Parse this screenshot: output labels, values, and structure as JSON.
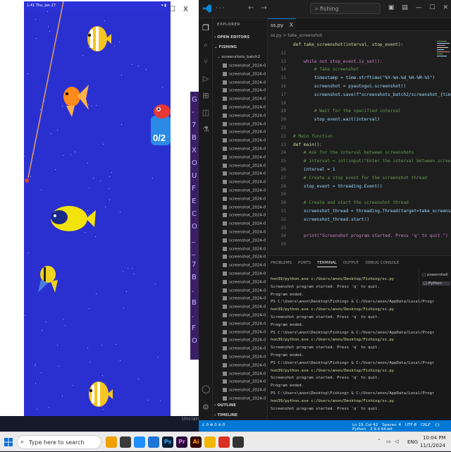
{
  "phone": {
    "status_time": "1:41 Thu, Jan 27",
    "window_restore": "☐",
    "window_close": "X",
    "catch_progress": "0/2"
  },
  "vscode": {
    "search": "fishing",
    "tab": "ss.py",
    "tab_close": "X",
    "breadcrumb": "ss.py > take_screenshot",
    "sidebar": {
      "header": "EXPLORER",
      "open_editors": "OPEN EDITORS",
      "root": "FISHING",
      "folder": "screenshots_batch2",
      "files": [
        "screenshot_2024-0...",
        "screenshot_2024-07...",
        "screenshot_2024-07...",
        "screenshot_2024-07...",
        "screenshot_2024-07...",
        "screenshot_2024-07...",
        "screenshot_2024-07...",
        "screenshot_2024-07...",
        "screenshot_2024-07...",
        "screenshot_2024-07...",
        "screenshot_2024-07...",
        "screenshot_2024-07...",
        "screenshot_2024-07...",
        "screenshot_2024-07...",
        "screenshot_2024-07...",
        "screenshot_2024-07...",
        "screenshot_2024-07...",
        "screenshot_2024-07...",
        "screenshot_2024-07...",
        "screenshot_2024-07...",
        "screenshot_2024-07...",
        "screenshot_2024-07...",
        "screenshot_2024-07...",
        "screenshot_2024-07...",
        "screenshot_2024-07...",
        "screenshot_2024-07...",
        "screenshot_2024-07...",
        "screenshot_2024-07...",
        "screenshot_2024-07...",
        "screenshot_2024-07...",
        "screenshot_2024-07...",
        "screenshot_2024-07...",
        "screenshot_2024-07...",
        "screenshot_2024-07...",
        "screenshot_2024-07...",
        "screenshot_2024-07...",
        "screenshot_2024-07...",
        "screenshot_2024-07...",
        "screenshot_2024-07...",
        "screenshot_2024-07...",
        "screenshot_2024-07..."
      ],
      "outline": "OUTLINE",
      "timeline": "TIMELINE"
    },
    "code_lines": [
      {
        "n": "",
        "t": "def take_screenshot(interval, stop_event):"
      },
      {
        "n": "12",
        "t": ""
      },
      {
        "n": "13",
        "t": "    while not stop_event.is_set():"
      },
      {
        "n": "14",
        "t": "        # Take screenshot"
      },
      {
        "n": "15",
        "t": "        timestamp = time.strftime(\"%Y-%m-%d_%H-%M-%S\")"
      },
      {
        "n": "16",
        "t": "        screenshot = pyautogui.screenshot()"
      },
      {
        "n": "17",
        "t": "        screenshot.save(f\"screenshots_batch2/screenshot_{timestamp}.png\")"
      },
      {
        "n": "18",
        "t": ""
      },
      {
        "n": "19",
        "t": "        # Wait for the specified interval"
      },
      {
        "n": "20",
        "t": "        stop_event.wait(interval)"
      },
      {
        "n": "21",
        "t": ""
      },
      {
        "n": "22",
        "t": "# Main function"
      },
      {
        "n": "23",
        "t": "def main():"
      },
      {
        "n": "24",
        "t": "    # Ask for the interval between screenshots"
      },
      {
        "n": "25",
        "t": "    # interval = int(input(\"Enter the interval between screenshots (in seconds): \"))"
      },
      {
        "n": "26",
        "t": "    interval = 1"
      },
      {
        "n": "27",
        "t": "    # Create a stop event for the screenshot thread"
      },
      {
        "n": "28",
        "t": "    stop_event = threading.Event()"
      },
      {
        "n": "29",
        "t": ""
      },
      {
        "n": "30",
        "t": "    # Create and start the screenshot thread"
      },
      {
        "n": "31",
        "t": "    screenshot_thread = threading.Thread(target=take_screenshot, args=(interval, sto"
      },
      {
        "n": "32",
        "t": "    screenshot_thread.start()"
      },
      {
        "n": "33",
        "t": ""
      },
      {
        "n": "34",
        "t": "    print(\"Screenshot program started. Press 'q' to quit.\")"
      },
      {
        "n": "35",
        "t": ""
      }
    ],
    "panel_tabs": [
      "PROBLEMS",
      "PORTS",
      "TERMINAL",
      "OUTPUT",
      "DEBUG CONSOLE"
    ],
    "terminal_list": [
      "powershell",
      "Python"
    ],
    "terminal_lines": [
      "hon39/python.exe c:/Users/anon/Desktop/Fishing/ss.py",
      "Screenshot program started. Press 'q' to quit.",
      "Program ended.",
      "PS C:\\Users\\anon\\Desktop\\Fishing> & C:/Users/anon/AppData/Local/Programs/Python/Pyt",
      "hon39/python.exe c:/Users/anon/Desktop/Fishing/ss.py",
      "Screenshot program started. Press 'q' to quit.",
      "Program ended.",
      "PS C:\\Users\\anon\\Desktop\\Fishing> & C:/Users/anon/AppData/Local/Programs/Python/Pyt",
      "hon39/python.exe c:/Users/anon/Desktop/Fishing/ss.py",
      "Screenshot program started. Press 'q' to quit.",
      "Program ended.",
      "PS C:\\Users\\anon\\Desktop\\Fishing> & C:/Users/anon/AppData/Local/Programs/Python/Pyt",
      "hon39/python.exe c:/Users/anon/Desktop/Fishing/ss.py",
      "Screenshot program started. Press 'q' to quit.",
      "Program ended.",
      "PS C:\\Users\\anon\\Desktop\\Fishing> & C:/Users/anon/AppData/Local/Programs/Python/Pyt",
      "hon39/python.exe c:/Users/anon/Desktop/Fishing/ss.py",
      "Screenshot program started. Press 'q' to quit.",
      ""
    ],
    "status_left": "⚠ 0 ⊗ 0   ⊘ 0",
    "status_right": [
      "Ln 19, Col 42",
      "Spaces: 4",
      "UTF-8",
      "CRLF",
      "{} Python",
      "3.9.4 64-bit"
    ]
  },
  "side_glyphs": [
    "G",
    "-",
    "7",
    "B",
    "X",
    "O",
    "U",
    "F",
    "E",
    "C",
    "O",
    "_",
    "_",
    "7",
    "B",
    ".",
    "B",
    ".",
    "F",
    "O"
  ],
  "desktop_caption": "Uncian",
  "taskbar": {
    "search_placeholder": "Type here to search",
    "apps": [
      "",
      "",
      "",
      "",
      "Ps",
      "Pr",
      "Ai",
      "",
      "",
      ""
    ],
    "lang": "ENG",
    "time": "10:04 PM",
    "date": "11/1/2024"
  }
}
